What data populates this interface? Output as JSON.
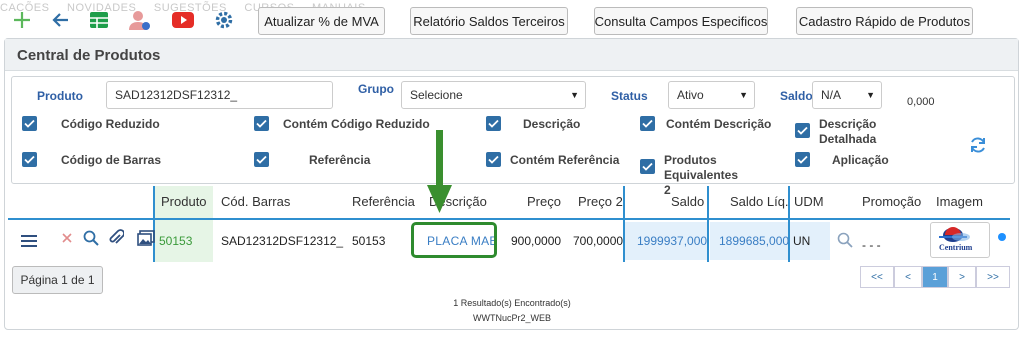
{
  "ghost_menu": [
    "CACÕES",
    "NOVIDADES",
    "SUGESTÕES",
    "CURSOS",
    "MANUAIS"
  ],
  "toolbar": {
    "icons": [
      "plus-icon",
      "arrow-left-icon",
      "grid-icon",
      "user-icon",
      "youtube-icon",
      "gear-icon"
    ],
    "buttons": [
      "Atualizar % de MVA",
      "Relatório Saldos Terceiros",
      "Consulta Campos Especificos",
      "Cadastro Rápido de Produtos"
    ]
  },
  "panel": {
    "title": "Central de Produtos"
  },
  "filters": {
    "produto_label": "Produto",
    "produto_value": "SAD12312DSF12312_",
    "grupo_label": "Grupo",
    "grupo_value": "Selecione",
    "status_label": "Status",
    "status_value": "Ativo",
    "saldo_label": "Saldo",
    "saldo_value": "N/A",
    "saldo_number": "0,000",
    "checkboxes": [
      "Código Reduzido",
      "Contém Código Reduzido",
      "Descrição",
      "Contém Descrição",
      "Descrição Detalhada",
      "Código de Barras",
      "Referência",
      "Contém Referência",
      "Produtos Equivalentes 2",
      "Aplicação"
    ]
  },
  "grid": {
    "headers": [
      "Produto",
      "Cód. Barras",
      "Referência",
      "Descrição",
      "Preço",
      "Preço 2",
      "Saldo",
      "Saldo Líq.",
      "UDM",
      "Promoção",
      "Imagem"
    ],
    "row": {
      "produto": "50153",
      "cod_barras": "SAD12312DSF12312_",
      "referencia": "50153",
      "descricao": "PLACA MAE",
      "preco": "900,0000",
      "preco2": "700,0000",
      "saldo": "1999937,000",
      "saldo_liq": "1899685,000",
      "udm": "UN",
      "promocao": "- - -",
      "image_text": "Centrium"
    }
  },
  "pager": {
    "info": "Página 1 de 1",
    "buttons": [
      "<<",
      "<",
      "1",
      ">",
      ">>"
    ]
  },
  "footer": {
    "results": "1 Resultado(s) Encontrado(s)",
    "object": "WWTNucPr2_WEB"
  },
  "colors": {
    "accent": "#2f6ea5",
    "grid_line": "#2f8fcf",
    "highlight": "#2e8b2e"
  }
}
